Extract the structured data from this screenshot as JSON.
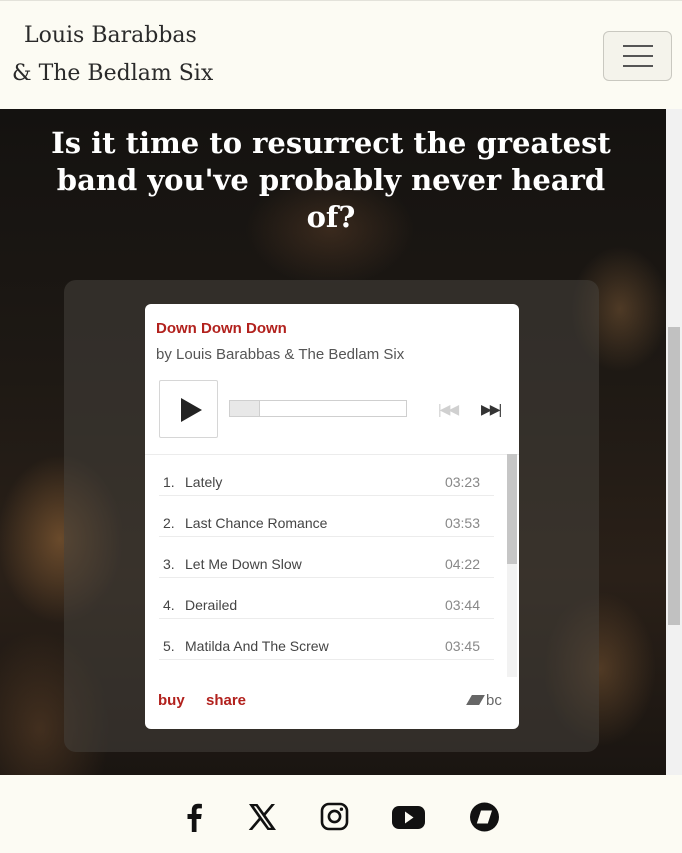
{
  "navbar": {
    "brand_line1": "Louis Barabbas",
    "brand_line2": "& The Bedlam Six",
    "menu_icon": "hamburger-icon"
  },
  "hero": {
    "headline": "Is it time to resurrect the greatest band you've probably never heard of?"
  },
  "player": {
    "album_title": "Down Down Down",
    "artist": "by Louis Barabbas & The Bedlam Six",
    "prev_glyph": "|◀◀",
    "next_glyph": "▶▶|",
    "tracks": [
      {
        "num": "1.",
        "name": "Lately",
        "duration": "03:23"
      },
      {
        "num": "2.",
        "name": "Last Chance Romance",
        "duration": "03:53"
      },
      {
        "num": "3.",
        "name": "Let Me Down Slow",
        "duration": "04:22"
      },
      {
        "num": "4.",
        "name": "Derailed",
        "duration": "03:44"
      },
      {
        "num": "5.",
        "name": "Matilda And The Screw",
        "duration": "03:45"
      }
    ],
    "buy_label": "buy",
    "share_label": "share",
    "logo_text": "bc",
    "accent_color": "#b2211d"
  },
  "footer": {
    "social_icons": [
      "facebook-icon",
      "x-icon",
      "instagram-icon",
      "youtube-icon",
      "bandcamp-icon"
    ]
  }
}
